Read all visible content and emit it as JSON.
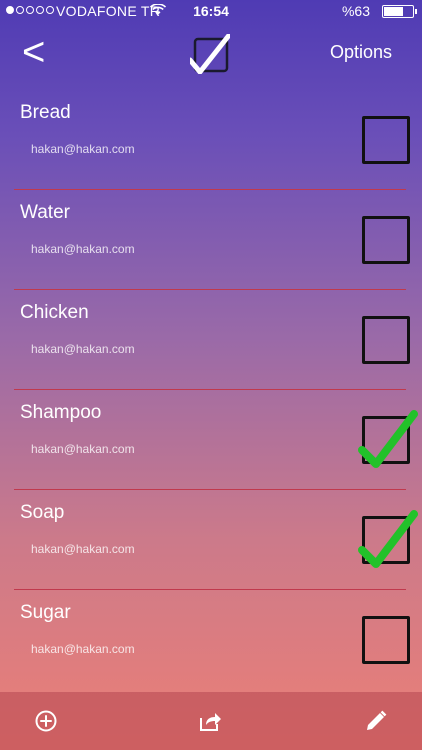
{
  "status_bar": {
    "carrier": "VODAFONE TR",
    "time": "16:54",
    "battery_text": "%63",
    "battery_level": 0.63
  },
  "nav": {
    "back_label": "<",
    "options_label": "Options"
  },
  "items": [
    {
      "title": "Bread",
      "email": "hakan@hakan.com",
      "checked": false
    },
    {
      "title": "Water",
      "email": "hakan@hakan.com",
      "checked": false
    },
    {
      "title": "Chicken",
      "email": "hakan@hakan.com",
      "checked": false
    },
    {
      "title": "Shampoo",
      "email": "hakan@hakan.com",
      "checked": true
    },
    {
      "title": "Soap",
      "email": "hakan@hakan.com",
      "checked": true
    },
    {
      "title": "Sugar",
      "email": "hakan@hakan.com",
      "checked": false
    }
  ],
  "colors": {
    "check_green": "#22c22a",
    "divider": "#c0394d"
  },
  "toolbar": {
    "icons": [
      "add-icon",
      "share-icon",
      "edit-icon"
    ]
  }
}
